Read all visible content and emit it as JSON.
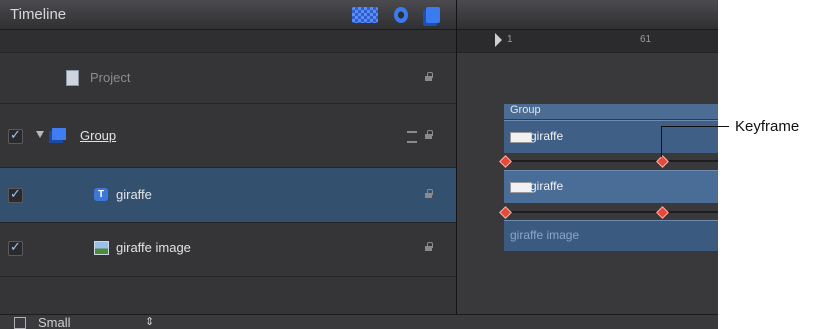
{
  "header": {
    "title": "Timeline"
  },
  "header_icons": [
    "checker-icon",
    "gear-icon",
    "layers-icon"
  ],
  "layers": [
    {
      "name": "Project",
      "checked": false,
      "icon": "document-icon"
    },
    {
      "name": "Group",
      "checked": true,
      "icon": "group-icon"
    },
    {
      "name": "giraffe",
      "checked": true,
      "icon": "text-icon",
      "selected": true
    },
    {
      "name": "giraffe image",
      "checked": true,
      "icon": "image-icon"
    }
  ],
  "timeline": {
    "ruler_labels": [
      "1",
      "61"
    ],
    "group_label": "Group",
    "track_giraffe_1": "giraffe",
    "track_giraffe_2": "giraffe",
    "track_image": "giraffe image"
  },
  "bottom": {
    "size_label": "Small"
  },
  "callout": {
    "label": "Keyframe"
  },
  "colors": {
    "accent": "#3f5f86",
    "selection": "#33506f",
    "keyframe": "#e24a3b"
  }
}
